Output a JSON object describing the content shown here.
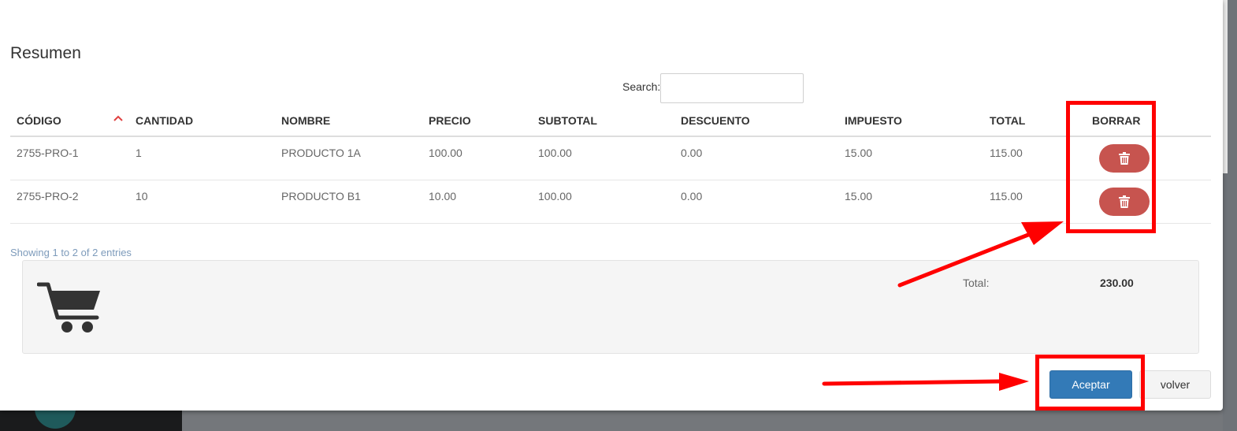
{
  "modal": {
    "title": "Resumen",
    "search": {
      "label": "Search:",
      "value": "",
      "placeholder": ""
    }
  },
  "table": {
    "columns": [
      "CÓDIGO",
      "CANTIDAD",
      "NOMBRE",
      "PRECIO",
      "SUBTOTAL",
      "DESCUENTO",
      "IMPUESTO",
      "TOTAL",
      "BORRAR"
    ],
    "sorted_column": "CÓDIGO",
    "rows": [
      {
        "codigo": "2755-PRO-1",
        "cantidad": "1",
        "nombre": "PRODUCTO 1A",
        "precio": "100.00",
        "subtotal": "100.00",
        "descuento": "0.00",
        "impuesto": "15.00",
        "total": "115.00"
      },
      {
        "codigo": "2755-PRO-2",
        "cantidad": "10",
        "nombre": "PRODUCTO B1",
        "precio": "10.00",
        "subtotal": "100.00",
        "descuento": "0.00",
        "impuesto": "15.00",
        "total": "115.00"
      }
    ],
    "info": "Showing 1 to 2 of 2 entries"
  },
  "summary": {
    "icon": "shopping-cart-icon",
    "total_label": "Total:",
    "total_value": "230.00"
  },
  "footer": {
    "accept_label": "Aceptar",
    "back_label": "volver"
  },
  "icons": {
    "delete": "trash-icon",
    "sort": "chevron-up-icon"
  },
  "colors": {
    "accept_button": "#337ab7",
    "delete_button": "#c7544f",
    "annotation": "#ff0000"
  }
}
